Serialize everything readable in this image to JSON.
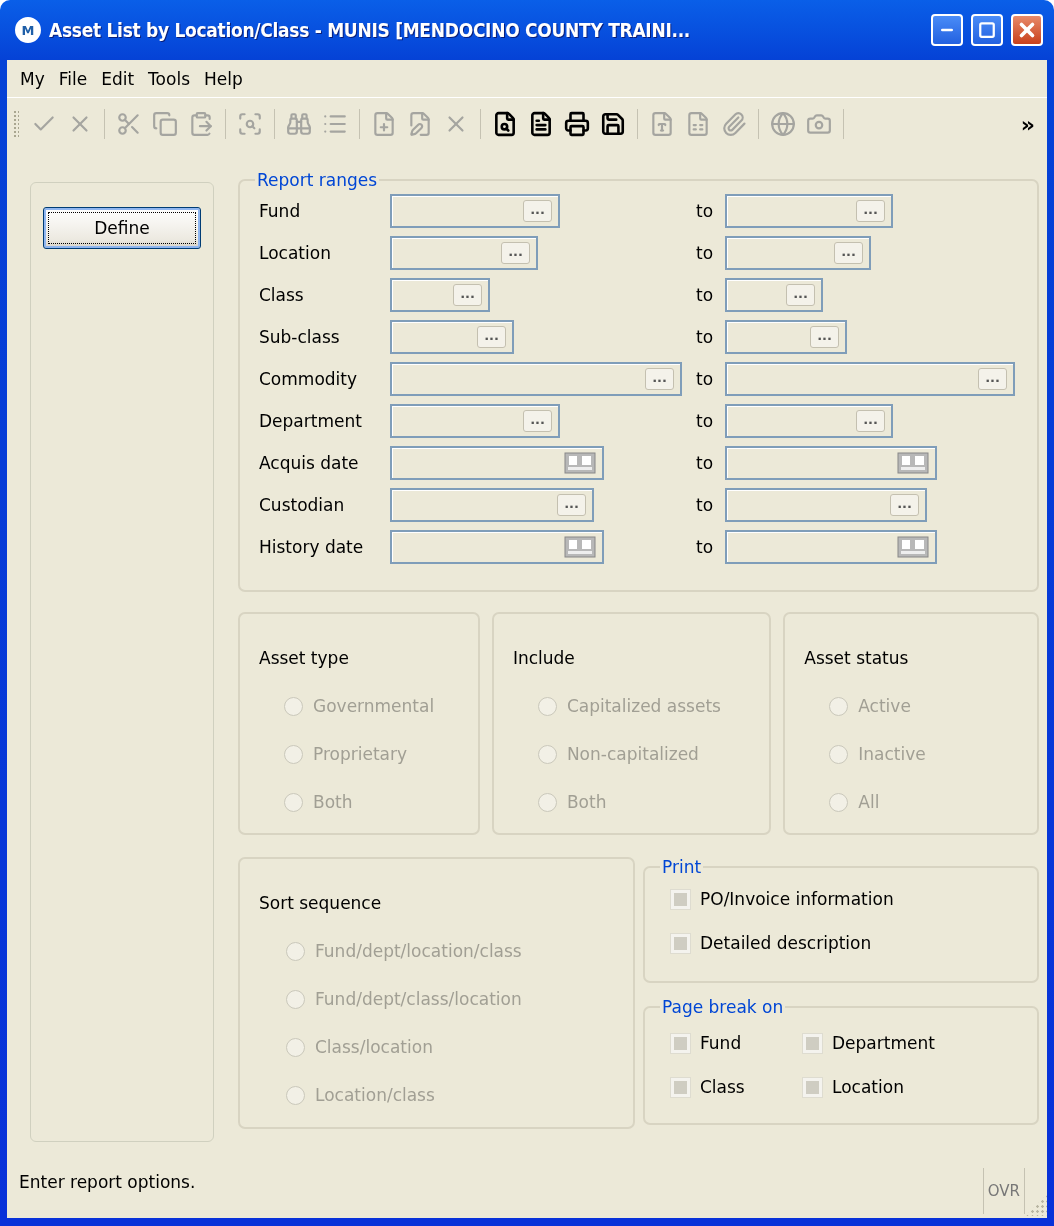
{
  "window": {
    "logo": "M",
    "title": "Asset List by Location/Class - MUNIS [MENDOCINO COUNTY TRAINI..."
  },
  "menu": [
    {
      "label": "My"
    },
    {
      "label": "File"
    },
    {
      "label": "Edit"
    },
    {
      "label": "Tools"
    },
    {
      "label": "Help"
    }
  ],
  "toolbar": {
    "items": [
      {
        "kind": "check",
        "disabled": true
      },
      {
        "kind": "cancel",
        "disabled": true
      },
      {
        "kind": "separator"
      },
      {
        "kind": "cut",
        "disabled": true
      },
      {
        "kind": "copy",
        "disabled": true
      },
      {
        "kind": "paste",
        "disabled": true
      },
      {
        "kind": "separator"
      },
      {
        "kind": "zoom",
        "disabled": true
      },
      {
        "kind": "separator"
      },
      {
        "kind": "binoculars",
        "disabled": true
      },
      {
        "kind": "list",
        "disabled": true
      },
      {
        "kind": "separator"
      },
      {
        "kind": "add",
        "disabled": true
      },
      {
        "kind": "edit",
        "disabled": true
      },
      {
        "kind": "delete",
        "disabled": true
      },
      {
        "kind": "separator"
      },
      {
        "kind": "preview",
        "disabled": false
      },
      {
        "kind": "document",
        "disabled": false
      },
      {
        "kind": "print",
        "disabled": false
      },
      {
        "kind": "save",
        "disabled": false
      },
      {
        "kind": "separator"
      },
      {
        "kind": "word",
        "disabled": true
      },
      {
        "kind": "excel",
        "disabled": true
      },
      {
        "kind": "attach",
        "disabled": true
      },
      {
        "kind": "separator"
      },
      {
        "kind": "globe",
        "disabled": true
      },
      {
        "kind": "camera",
        "disabled": true
      },
      {
        "kind": "separator"
      }
    ],
    "overflow": "»"
  },
  "define_button": "Define",
  "report_ranges": {
    "title": "Report ranges",
    "rows": [
      {
        "label": "Fund",
        "to": "to",
        "from_field": {
          "kind": "lookup",
          "button": "..."
        },
        "to_field": {
          "kind": "lookup",
          "button": "..."
        }
      },
      {
        "label": "Location",
        "to": "to",
        "from_field": {
          "kind": "lookup",
          "button": "..."
        },
        "to_field": {
          "kind": "lookup",
          "button": "..."
        }
      },
      {
        "label": "Class",
        "to": "to",
        "from_field": {
          "kind": "lookup",
          "button": "..."
        },
        "to_field": {
          "kind": "lookup",
          "button": "..."
        }
      },
      {
        "label": "Sub-class",
        "to": "to",
        "from_field": {
          "kind": "lookup",
          "button": "..."
        },
        "to_field": {
          "kind": "lookup",
          "button": "..."
        }
      },
      {
        "label": "Commodity",
        "to": "to",
        "from_field": {
          "kind": "lookup",
          "button": "..."
        },
        "to_field": {
          "kind": "lookup",
          "button": "..."
        }
      },
      {
        "label": "Department",
        "to": "to",
        "from_field": {
          "kind": "lookup",
          "button": "..."
        },
        "to_field": {
          "kind": "lookup",
          "button": "..."
        }
      },
      {
        "label": "Acquis date",
        "to": "to",
        "from_field": {
          "kind": "date"
        },
        "to_field": {
          "kind": "date"
        }
      },
      {
        "label": "Custodian",
        "to": "to",
        "from_field": {
          "kind": "lookup",
          "button": "..."
        },
        "to_field": {
          "kind": "lookup",
          "button": "..."
        }
      },
      {
        "label": "History date",
        "to": "to",
        "from_field": {
          "kind": "date"
        },
        "to_field": {
          "kind": "date"
        }
      }
    ]
  },
  "radio_groups": [
    {
      "title": "Asset type",
      "options": [
        {
          "label": "Governmental",
          "selected": false,
          "disabled": true
        },
        {
          "label": "Proprietary",
          "selected": false,
          "disabled": true
        },
        {
          "label": "Both",
          "selected": false,
          "disabled": true
        }
      ]
    },
    {
      "title": "Include",
      "options": [
        {
          "label": "Capitalized assets",
          "selected": false,
          "disabled": true
        },
        {
          "label": "Non-capitalized",
          "selected": false,
          "disabled": true
        },
        {
          "label": "Both",
          "selected": false,
          "disabled": true
        }
      ]
    },
    {
      "title": "Asset status",
      "options": [
        {
          "label": "Active",
          "selected": false,
          "disabled": true
        },
        {
          "label": "Inactive",
          "selected": false,
          "disabled": true
        },
        {
          "label": "All",
          "selected": false,
          "disabled": true
        }
      ]
    }
  ],
  "sort_sequence": {
    "title": "Sort sequence",
    "options": [
      {
        "label": "Fund/dept/location/class",
        "selected": false,
        "disabled": true
      },
      {
        "label": "Fund/dept/class/location",
        "selected": false,
        "disabled": true
      },
      {
        "label": "Class/location",
        "selected": false,
        "disabled": true
      },
      {
        "label": "Location/class",
        "selected": false,
        "disabled": true
      }
    ]
  },
  "print": {
    "title": "Print",
    "options": [
      {
        "label": "PO/Invoice information",
        "checked": false,
        "disabled": true
      },
      {
        "label": "Detailed description",
        "checked": false,
        "disabled": true
      }
    ]
  },
  "page_break_on": {
    "title": "Page break on",
    "options": [
      {
        "label": "Fund",
        "checked": false,
        "disabled": true
      },
      {
        "label": "Department",
        "checked": false,
        "disabled": true
      },
      {
        "label": "Class",
        "checked": false,
        "disabled": true
      },
      {
        "label": "Location",
        "checked": false,
        "disabled": true
      }
    ]
  },
  "status_bar": {
    "message": "Enter report options.",
    "mode": "OVR"
  }
}
